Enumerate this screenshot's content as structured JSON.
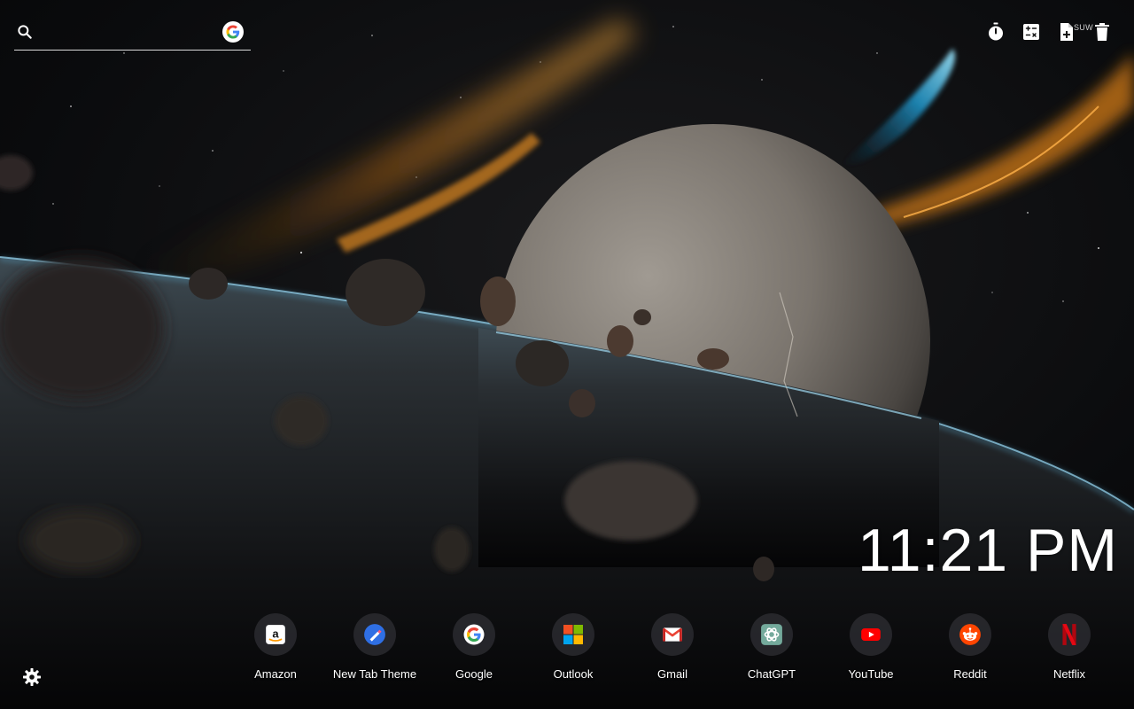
{
  "search": {
    "placeholder": "",
    "engine_icon": "google-icon"
  },
  "toolbar": {
    "tools": [
      {
        "name": "timer-icon"
      },
      {
        "name": "calculator-icon"
      },
      {
        "name": "new-note-icon"
      },
      {
        "name": "trash-icon"
      }
    ],
    "sidebar_label": "SUW"
  },
  "clock": {
    "time": "11:21 PM"
  },
  "shortcuts": [
    {
      "label": "Amazon",
      "icon": "amazon-icon"
    },
    {
      "label": "New Tab Theme",
      "icon": "new-tab-theme-icon"
    },
    {
      "label": "Google",
      "icon": "google-icon"
    },
    {
      "label": "Outlook",
      "icon": "microsoft-icon"
    },
    {
      "label": "Gmail",
      "icon": "gmail-icon"
    },
    {
      "label": "ChatGPT",
      "icon": "chatgpt-icon"
    },
    {
      "label": "YouTube",
      "icon": "youtube-icon"
    },
    {
      "label": "Reddit",
      "icon": "reddit-icon"
    },
    {
      "label": "Netflix",
      "icon": "netflix-icon"
    }
  ],
  "settings": {
    "icon": "gear-icon"
  },
  "colors": {
    "amazon": "#ff9900",
    "new_tab_theme": "#2f6fe4",
    "microsoft_red": "#f25022",
    "microsoft_green": "#7fba00",
    "microsoft_blue": "#00a4ef",
    "microsoft_yellow": "#ffb900",
    "gmail": "#ea4335",
    "chatgpt": "#74aa9c",
    "youtube": "#ff0000",
    "reddit": "#ff4500",
    "netflix": "#e50914"
  }
}
